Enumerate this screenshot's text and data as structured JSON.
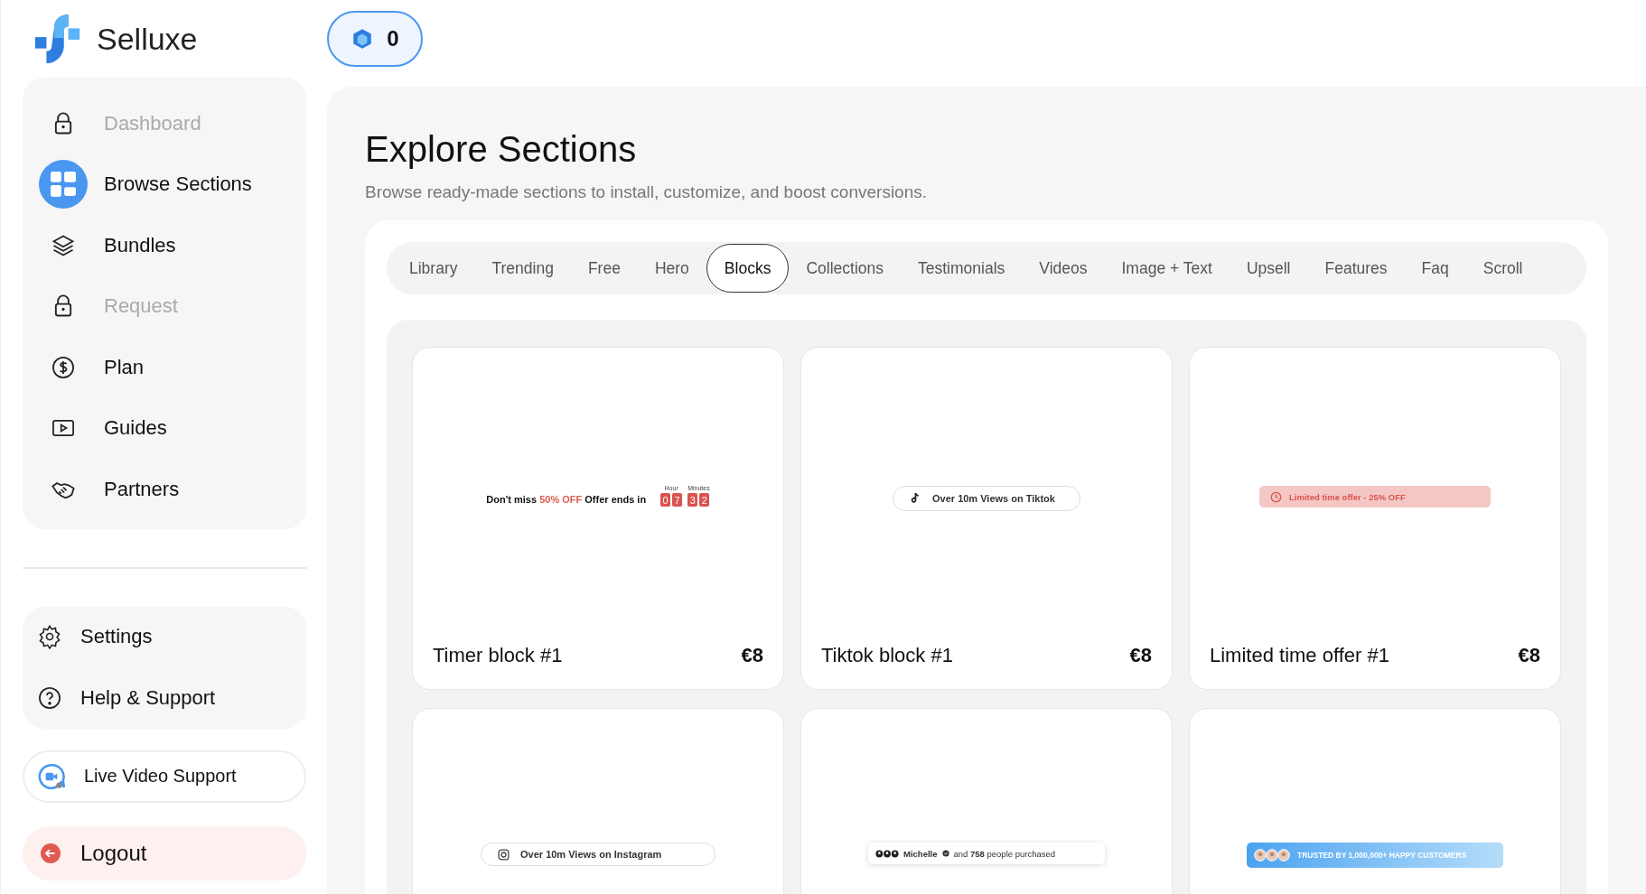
{
  "brand": {
    "name": "Selluxe"
  },
  "credits": {
    "value": "0"
  },
  "nav": [
    {
      "label": "Dashboard",
      "disabled": true,
      "selected": false
    },
    {
      "label": "Browse Sections",
      "disabled": false,
      "selected": true
    },
    {
      "label": "Bundles",
      "disabled": false,
      "selected": false
    },
    {
      "label": "Request",
      "disabled": true,
      "selected": false
    },
    {
      "label": "Plan",
      "disabled": false,
      "selected": false
    },
    {
      "label": "Guides",
      "disabled": false,
      "selected": false
    },
    {
      "label": "Partners",
      "disabled": false,
      "selected": false
    }
  ],
  "support": [
    {
      "label": "Settings"
    },
    {
      "label": "Help & Support"
    }
  ],
  "live_support": {
    "label": "Live Video Support"
  },
  "logout": {
    "label": "Logout"
  },
  "page": {
    "title": "Explore Sections",
    "subtitle": "Browse ready-made sections to install, customize, and boost conversions."
  },
  "tabs": [
    {
      "label": "Library",
      "selected": false
    },
    {
      "label": "Trending",
      "selected": false
    },
    {
      "label": "Free",
      "selected": false
    },
    {
      "label": "Hero",
      "selected": false
    },
    {
      "label": "Blocks",
      "selected": true
    },
    {
      "label": "Collections",
      "selected": false
    },
    {
      "label": "Testimonials",
      "selected": false
    },
    {
      "label": "Videos",
      "selected": false
    },
    {
      "label": "Image + Text",
      "selected": false
    },
    {
      "label": "Upsell",
      "selected": false
    },
    {
      "label": "Features",
      "selected": false
    },
    {
      "label": "Faq",
      "selected": false
    },
    {
      "label": "Scroll",
      "selected": false
    }
  ],
  "cards": [
    {
      "title": "Timer block #1",
      "price": "€8",
      "preview": {
        "kind": "timer",
        "lead": "Don't miss",
        "highlight": "50% OFF",
        "tail": "Offer ends in",
        "units": [
          {
            "label": "Hour",
            "digits": [
              "0",
              "7"
            ]
          },
          {
            "label": "Minutes",
            "digits": [
              "3",
              "2"
            ]
          }
        ]
      }
    },
    {
      "title": "Tiktok block #1",
      "price": "€8",
      "preview": {
        "kind": "tiktok",
        "text": "Over 10m Views on Tiktok"
      }
    },
    {
      "title": "Limited time offer #1",
      "price": "€8",
      "preview": {
        "kind": "offer",
        "text": "Limited time offer - 25% OFF"
      }
    },
    {
      "preview": {
        "kind": "instagram",
        "text": "Over 10m Views on Instagram"
      }
    },
    {
      "preview": {
        "kind": "purchased",
        "name": "Michelle",
        "text": "and **758** people purchased"
      }
    },
    {
      "preview": {
        "kind": "trusted",
        "text": "TRUSTED BY 1,000,000+ HAPPY CUSTOMERS"
      }
    }
  ]
}
